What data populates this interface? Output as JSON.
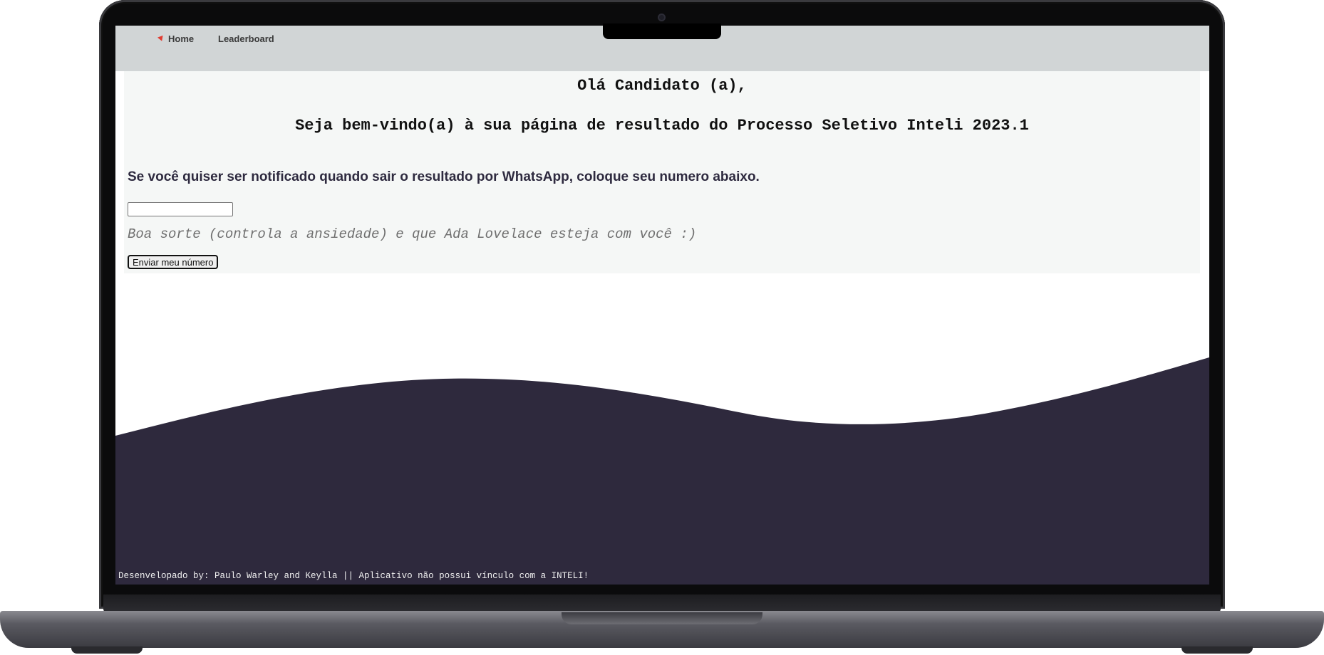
{
  "nav": {
    "items": [
      {
        "label": "Home"
      },
      {
        "label": "Leaderboard"
      }
    ]
  },
  "main": {
    "greeting": "Olá Candidato (a),",
    "welcome": "Seja bem-vindo(a) à sua página de resultado do Processo Seletivo Inteli 2023.1",
    "notify_text": "Se você quiser ser notificado quando sair o resultado por WhatsApp, coloque seu numero abaixo.",
    "phone_input": {
      "value": "",
      "placeholder": ""
    },
    "luck_text": "Boa sorte (controla a ansiedade) e que Ada Lovelace esteja com você :)",
    "send_button_label": "Enviar meu número"
  },
  "footer": {
    "text": "Desenvelopado by: Paulo Warley and Keylla || Aplicativo não possui vínculo com a INTELI!"
  },
  "colors": {
    "navbar": "#d1d5d6",
    "panel": "#f5f7f6",
    "wave": "#2e293d",
    "heading_text": "#2e2a3f",
    "home_marker": "#e03c31"
  },
  "icons": {
    "home_marker": "red-triangle-marker-icon"
  }
}
